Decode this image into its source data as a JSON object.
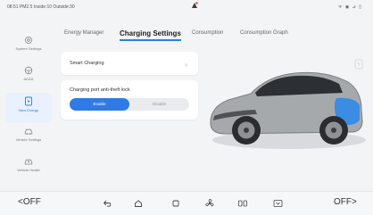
{
  "status": {
    "left_text": "08:51 PM2.5 Inside:10 Outside:30",
    "right_text": "ᯤ ◉ ⊿ ▯"
  },
  "sidebar": {
    "items": [
      {
        "label": "System Settings",
        "icon": "system-settings-icon",
        "active": false
      },
      {
        "label": "ADAS",
        "icon": "adas-icon",
        "active": false
      },
      {
        "label": "New Energy",
        "icon": "new-energy-icon",
        "active": true
      },
      {
        "label": "Vehicle Settings",
        "icon": "vehicle-settings-icon",
        "active": false
      },
      {
        "label": "Vehicle Health",
        "icon": "vehicle-health-icon",
        "active": false
      }
    ]
  },
  "tabs": [
    {
      "label": "Energy Manager",
      "active": false
    },
    {
      "label": "Charging Settings",
      "active": true
    },
    {
      "label": "Consumption",
      "active": false
    },
    {
      "label": "Consumption Graph",
      "active": false
    }
  ],
  "smart_charging": {
    "label": "Smart Charging",
    "chevron": "›"
  },
  "anti_theft": {
    "label": "Charging port anti-theft lock",
    "options": [
      "Enable",
      "Disable"
    ],
    "selected": "Enable"
  },
  "bottom": {
    "left_temp": "OFF",
    "right_temp": "OFF",
    "icons": [
      "back-icon",
      "home-icon",
      "recent-apps-icon",
      "fan-icon",
      "seat-heat-icon",
      "defrost-icon"
    ]
  },
  "colors": {
    "accent": "#2f7be6",
    "car_body": "#a7aaad",
    "charge_port": "#2f8ae8"
  }
}
